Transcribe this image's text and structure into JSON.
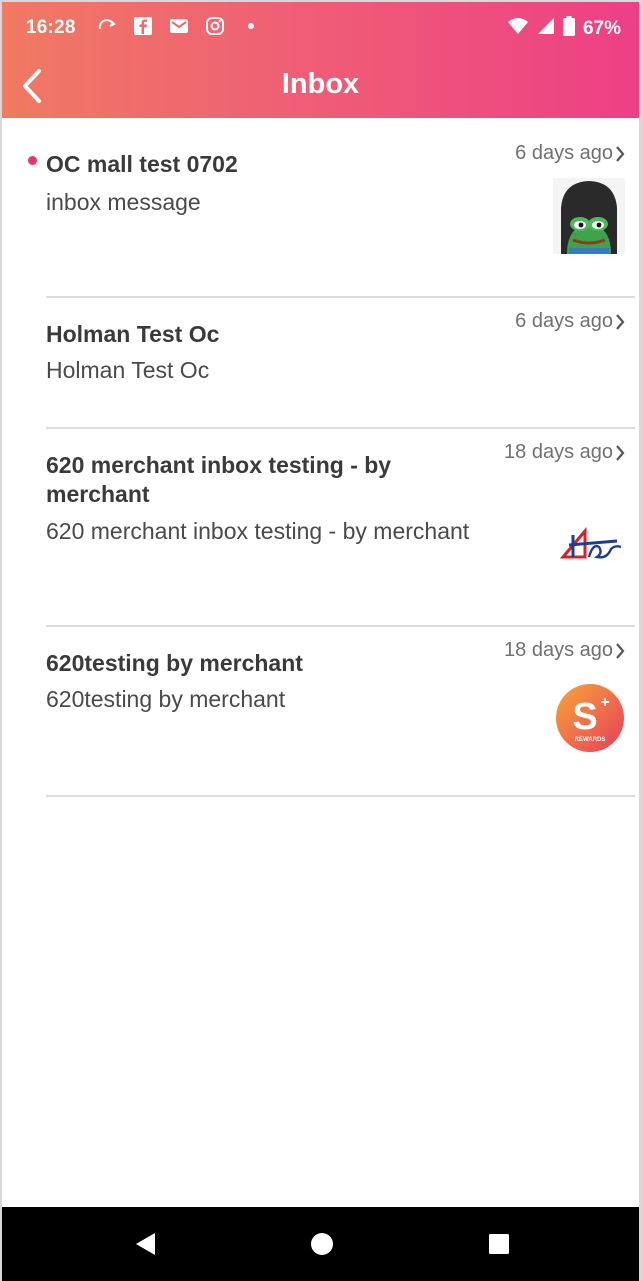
{
  "status_bar": {
    "time": "16:28",
    "battery": "67%",
    "icons_left": [
      "sync-icon",
      "facebook-icon",
      "mail-icon",
      "instagram-icon",
      "dot-icon"
    ],
    "icons_right": [
      "wifi-icon",
      "signal-icon",
      "battery-icon"
    ]
  },
  "header": {
    "title": "Inbox",
    "gradient": [
      "#f07a62",
      "#ee3f86"
    ]
  },
  "messages": [
    {
      "title": "OC mall test 0702",
      "body": "inbox message",
      "time": "6 days ago",
      "unread": true,
      "thumbnail": "frog-avatar-image"
    },
    {
      "title": "Holman Test Oc",
      "body": "Holman Test Oc",
      "time": "6 days ago",
      "unread": false,
      "thumbnail": ""
    },
    {
      "title": "620 merchant inbox testing - by merchant",
      "body": "620 merchant inbox testing - by merchant",
      "time": "18 days ago",
      "unread": false,
      "thumbnail": "merchant-logo-image"
    },
    {
      "title": "620testing by merchant",
      "body": "620testing by merchant",
      "time": "18 days ago",
      "unread": false,
      "thumbnail": "s-rewards-logo",
      "thumbnail_text": "REWARDS"
    }
  ],
  "colors": {
    "unread_dot": "#e8346e",
    "divider": "#dcdcdc"
  },
  "system_nav": [
    "back-triangle-icon",
    "home-circle-icon",
    "recents-square-icon"
  ]
}
